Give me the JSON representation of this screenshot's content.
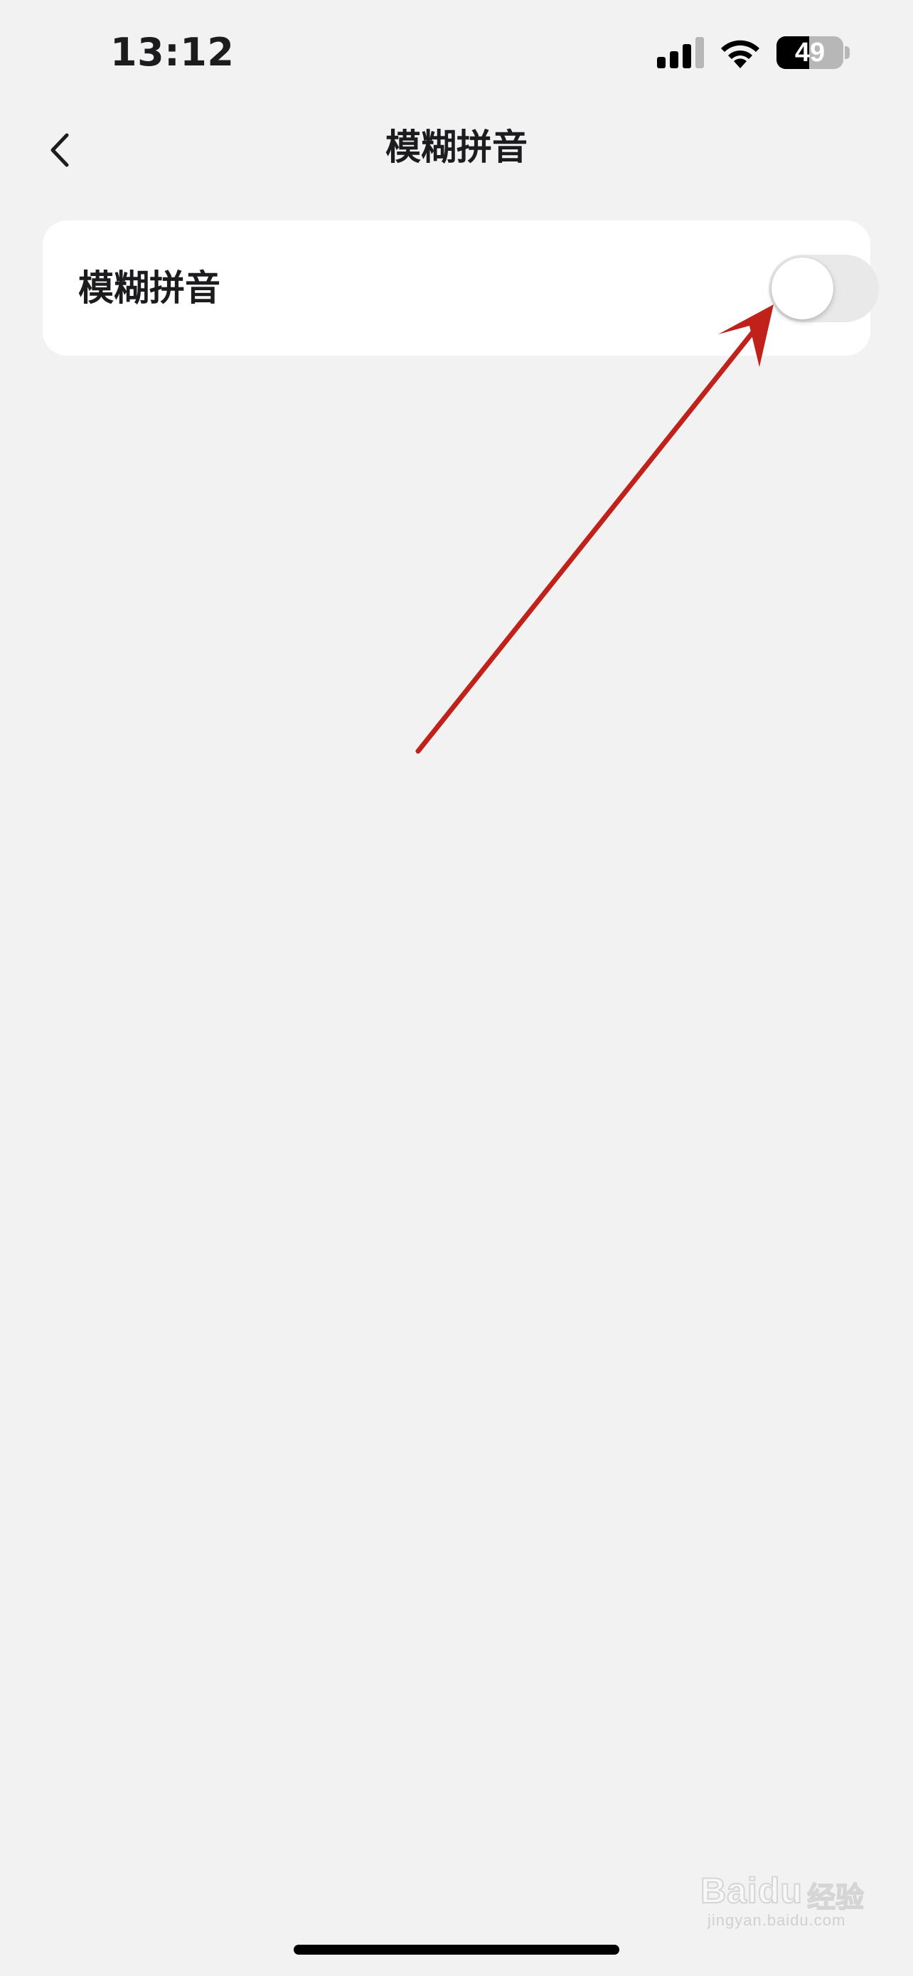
{
  "status_bar": {
    "time": "13:12",
    "battery_level": "49",
    "battery_fraction": 0.49
  },
  "nav": {
    "title": "模糊拼音",
    "back_icon": "chevron-left-icon"
  },
  "settings": {
    "fuzzy_pinyin": {
      "label": "模糊拼音",
      "enabled": false
    }
  },
  "annotation": {
    "type": "arrow",
    "color": "#c0211a",
    "target": "fuzzy-pinyin-toggle"
  },
  "watermark": {
    "brand": "Bai",
    "brand_suffix": "du",
    "label": "经验",
    "url": "jingyan.baidu.com"
  },
  "colors": {
    "background": "#f2f2f2",
    "card": "#ffffff",
    "toggle_off": "#e9e9ea",
    "annotation": "#c0211a"
  }
}
